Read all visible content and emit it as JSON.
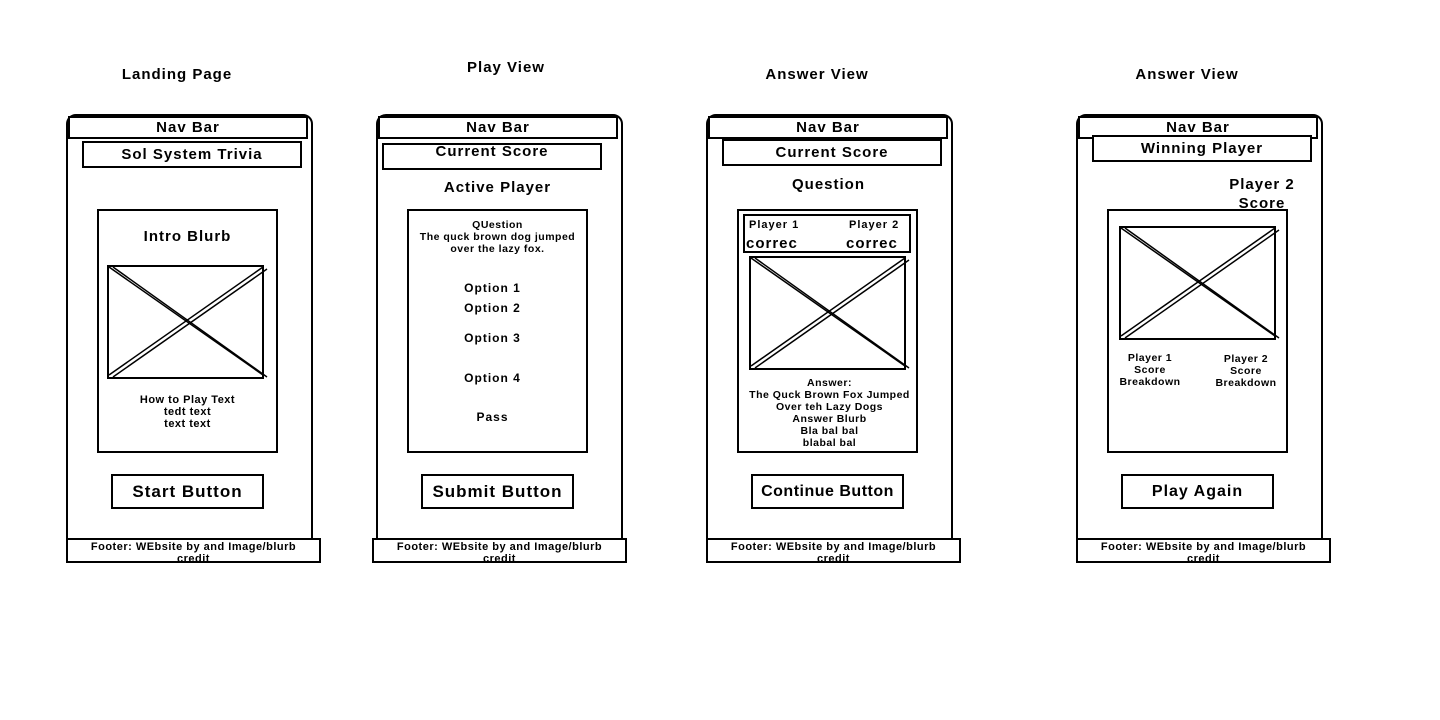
{
  "common": {
    "nav_bar": "Nav Bar",
    "footer": "Footer: WEbsite by and Image/blurb credit"
  },
  "landing": {
    "title": "Landing Page",
    "header": "Sol System Trivia",
    "intro": "Intro Blurb",
    "how_to": [
      "How to Play Text",
      "tedt text",
      "text text"
    ],
    "button": "Start Button"
  },
  "play": {
    "title": "Play View",
    "header": "Current Score",
    "active_player": "Active Player",
    "question_label": "QUestion",
    "question_text": [
      "The quck brown dog jumped",
      "over the lazy fox."
    ],
    "options": [
      "Option 1",
      "Option 2",
      "Option 3",
      "Option 4",
      "Pass"
    ],
    "button": "Submit Button"
  },
  "answer": {
    "title": "Answer View",
    "header": "Current Score",
    "question": "Question",
    "player1": "Player 1",
    "player2": "Player 2",
    "player1_status": "correc",
    "player2_status": "correc",
    "answer_lines": [
      "Answer:",
      "The Quck Brown Fox Jumped",
      "Over teh Lazy Dogs",
      "Answer Blurb",
      "Bla bal bal",
      "blabal bal"
    ],
    "button": "Continue Button"
  },
  "final": {
    "title": "Answer View",
    "header": "Winning Player",
    "score_lines": [
      "Player 2",
      "Score"
    ],
    "p1_breakdown": [
      "Player 1",
      "Score",
      "Breakdown"
    ],
    "p2_breakdown": [
      "Player 2",
      "Score",
      "Breakdown"
    ],
    "button": "Play Again"
  }
}
